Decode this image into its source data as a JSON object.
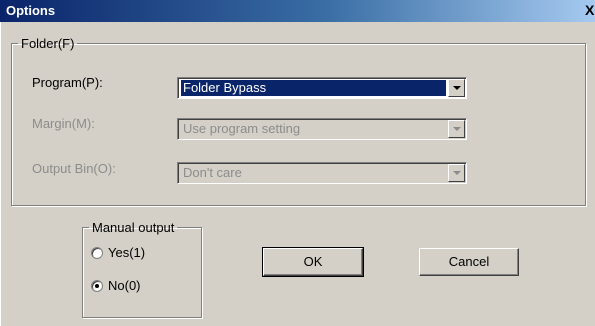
{
  "window": {
    "title": "Options",
    "close_glyph": "X"
  },
  "folder_group": {
    "legend": "Folder(F)",
    "program": {
      "label": "Program(P):",
      "value": "Folder Bypass"
    },
    "margin": {
      "label": "Margin(M):",
      "value": "Use program setting"
    },
    "output_bin": {
      "label": "Output Bin(O):",
      "value": "Don't care"
    }
  },
  "manual_output": {
    "legend": "Manual output",
    "yes": {
      "label": "Yes(1)",
      "checked": false
    },
    "no": {
      "label": "No(0)",
      "checked": true
    }
  },
  "buttons": {
    "ok": "OK",
    "cancel": "Cancel"
  }
}
